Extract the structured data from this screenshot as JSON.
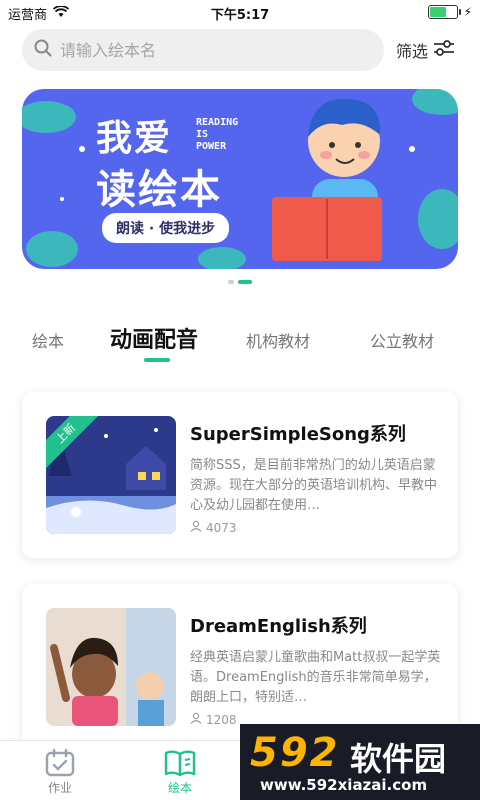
{
  "status_bar": {
    "carrier": "运营商",
    "time": "下午5:17",
    "battery_level": 0.6
  },
  "search": {
    "placeholder": "请输入绘本名"
  },
  "filter": {
    "label": "筛选"
  },
  "banner": {
    "title_line1": "我爱",
    "title_line2": "读绘本",
    "english_lines": [
      "READING",
      "IS",
      "POWER"
    ],
    "pill": "朗读 · 使我进步",
    "page_count": 2,
    "active_index": 1
  },
  "tabs": [
    {
      "label": "绘本",
      "active": false
    },
    {
      "label": "动画配音",
      "active": true
    },
    {
      "label": "机构教材",
      "active": false
    },
    {
      "label": "公立教材",
      "active": false
    }
  ],
  "cards": [
    {
      "title": "SuperSimpleSong系列",
      "description": "简称SSS，是目前非常热门的幼儿英语启蒙资源。现在大部分的英语培训机构、早教中心及幼儿园都在使用…",
      "count": "4073",
      "badge": "上新"
    },
    {
      "title": "DreamEnglish系列",
      "description": "经典英语启蒙儿童歌曲和Matt叔叔一起学英语。DreamEnglish的音乐非常简单易学，朗朗上口，特别适…",
      "count": "1208",
      "badge": ""
    }
  ],
  "bottom_nav": [
    {
      "label": "作业",
      "active": false
    },
    {
      "label": "绘本",
      "active": true
    }
  ],
  "watermark": {
    "brand_number": "592",
    "brand_cn": "软件园",
    "url": "www.592xiazai.com"
  },
  "colors": {
    "accent": "#22c08f",
    "banner_bg": "#5566ee",
    "watermark_orange": "#ffb400"
  }
}
